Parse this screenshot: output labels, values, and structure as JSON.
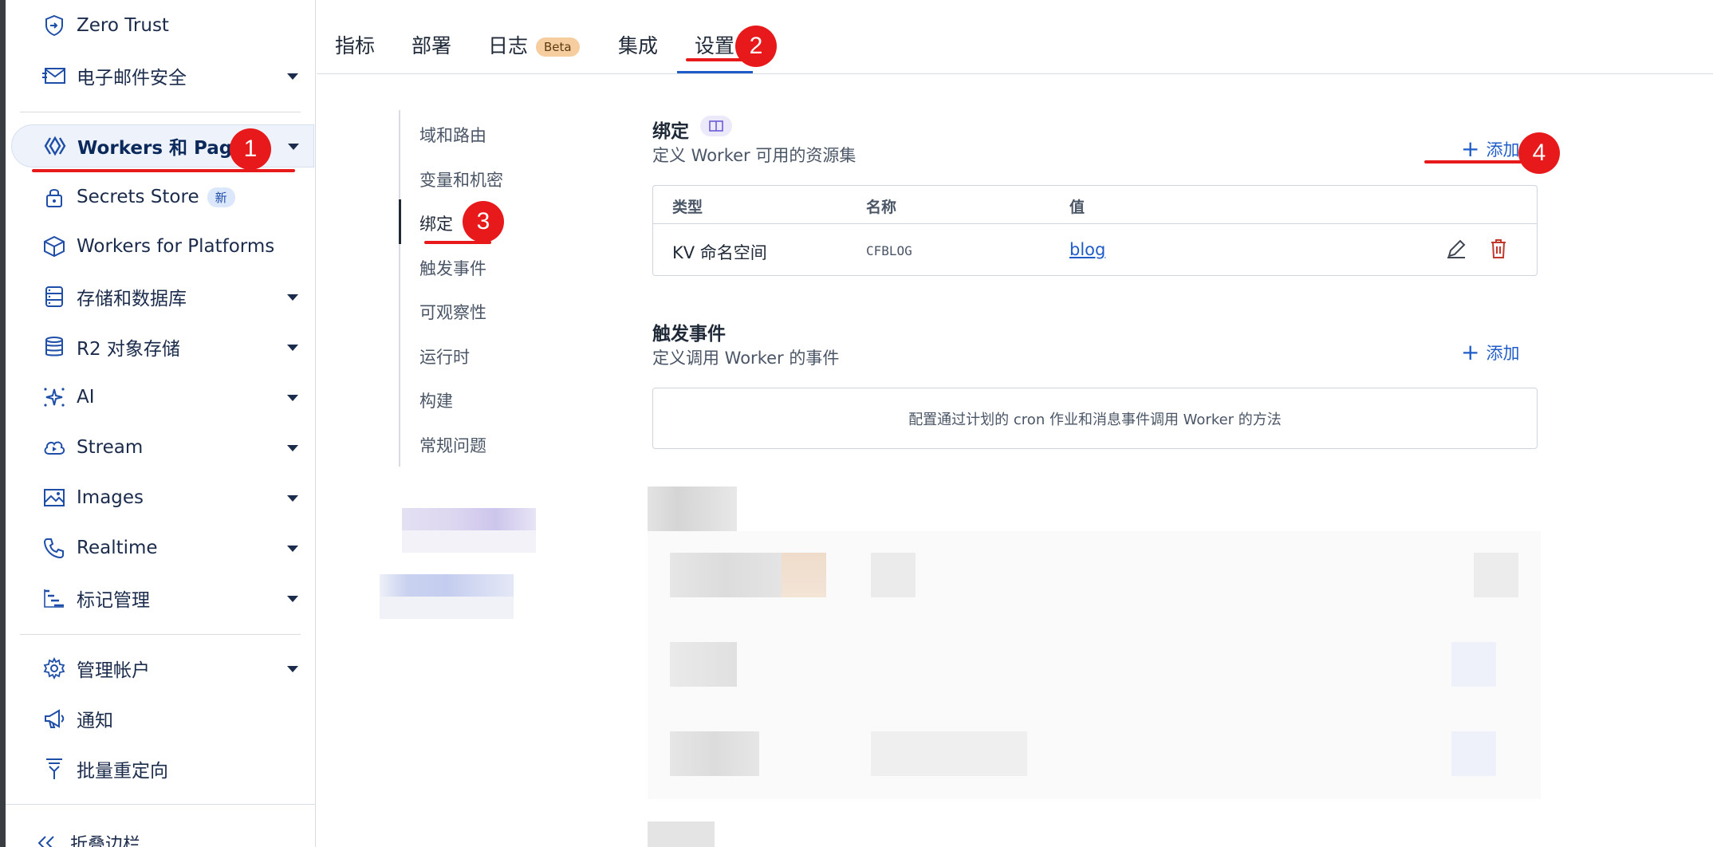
{
  "sidebar": {
    "items": [
      {
        "label": "Zero Trust",
        "icon": "zero-trust-icon",
        "caret": false
      },
      {
        "label": "电子邮件安全",
        "icon": "email-icon",
        "caret": true
      },
      {
        "label": "Workers 和 Pages",
        "icon": "workers-icon",
        "caret": true
      },
      {
        "label": "Secrets Store",
        "icon": "lock-icon",
        "caret": false,
        "badge": "新"
      },
      {
        "label": "Workers for Platforms",
        "icon": "box-icon",
        "caret": false
      },
      {
        "label": "存储和数据库",
        "icon": "storage-icon",
        "caret": true
      },
      {
        "label": "R2 对象存储",
        "icon": "database-icon",
        "caret": true
      },
      {
        "label": "AI",
        "icon": "sparkle-icon",
        "caret": true
      },
      {
        "label": "Stream",
        "icon": "stream-icon",
        "caret": true
      },
      {
        "label": "Images",
        "icon": "image-icon",
        "caret": true
      },
      {
        "label": "Realtime",
        "icon": "phone-icon",
        "caret": true
      },
      {
        "label": "标记管理",
        "icon": "tag-manager-icon",
        "caret": true
      },
      {
        "label": "管理帐户",
        "icon": "gear-icon",
        "caret": true
      },
      {
        "label": "通知",
        "icon": "megaphone-icon",
        "caret": false
      },
      {
        "label": "批量重定向",
        "icon": "redirect-icon",
        "caret": false
      }
    ],
    "collapse_label": "折叠边栏"
  },
  "tabs": [
    {
      "label": "指标"
    },
    {
      "label": "部署"
    },
    {
      "label": "日志",
      "badge": "Beta"
    },
    {
      "label": "集成"
    },
    {
      "label": "设置"
    }
  ],
  "subnav": [
    {
      "label": "域和路由"
    },
    {
      "label": "变量和机密"
    },
    {
      "label": "绑定"
    },
    {
      "label": "触发事件"
    },
    {
      "label": "可观察性"
    },
    {
      "label": "运行时"
    },
    {
      "label": "构建"
    },
    {
      "label": "常规问题"
    }
  ],
  "bindings": {
    "title": "绑定",
    "description": "定义 Worker 可用的资源集",
    "add_label": "添加",
    "table": {
      "headers": [
        "类型",
        "名称",
        "值"
      ],
      "rows": [
        {
          "type": "KV 命名空间",
          "name": "CFBLOG",
          "value": "blog"
        }
      ]
    }
  },
  "triggers": {
    "title": "触发事件",
    "description": "定义调用 Worker 的事件",
    "add_label": "添加",
    "empty_text": "配置通过计划的 cron 作业和消息事件调用 Worker 的方法"
  },
  "annotations": [
    "1",
    "2",
    "3",
    "4"
  ],
  "colors": {
    "accent": "#1f5cc9",
    "annotation_red": "#e8191b",
    "delete_red": "#c0392b"
  }
}
